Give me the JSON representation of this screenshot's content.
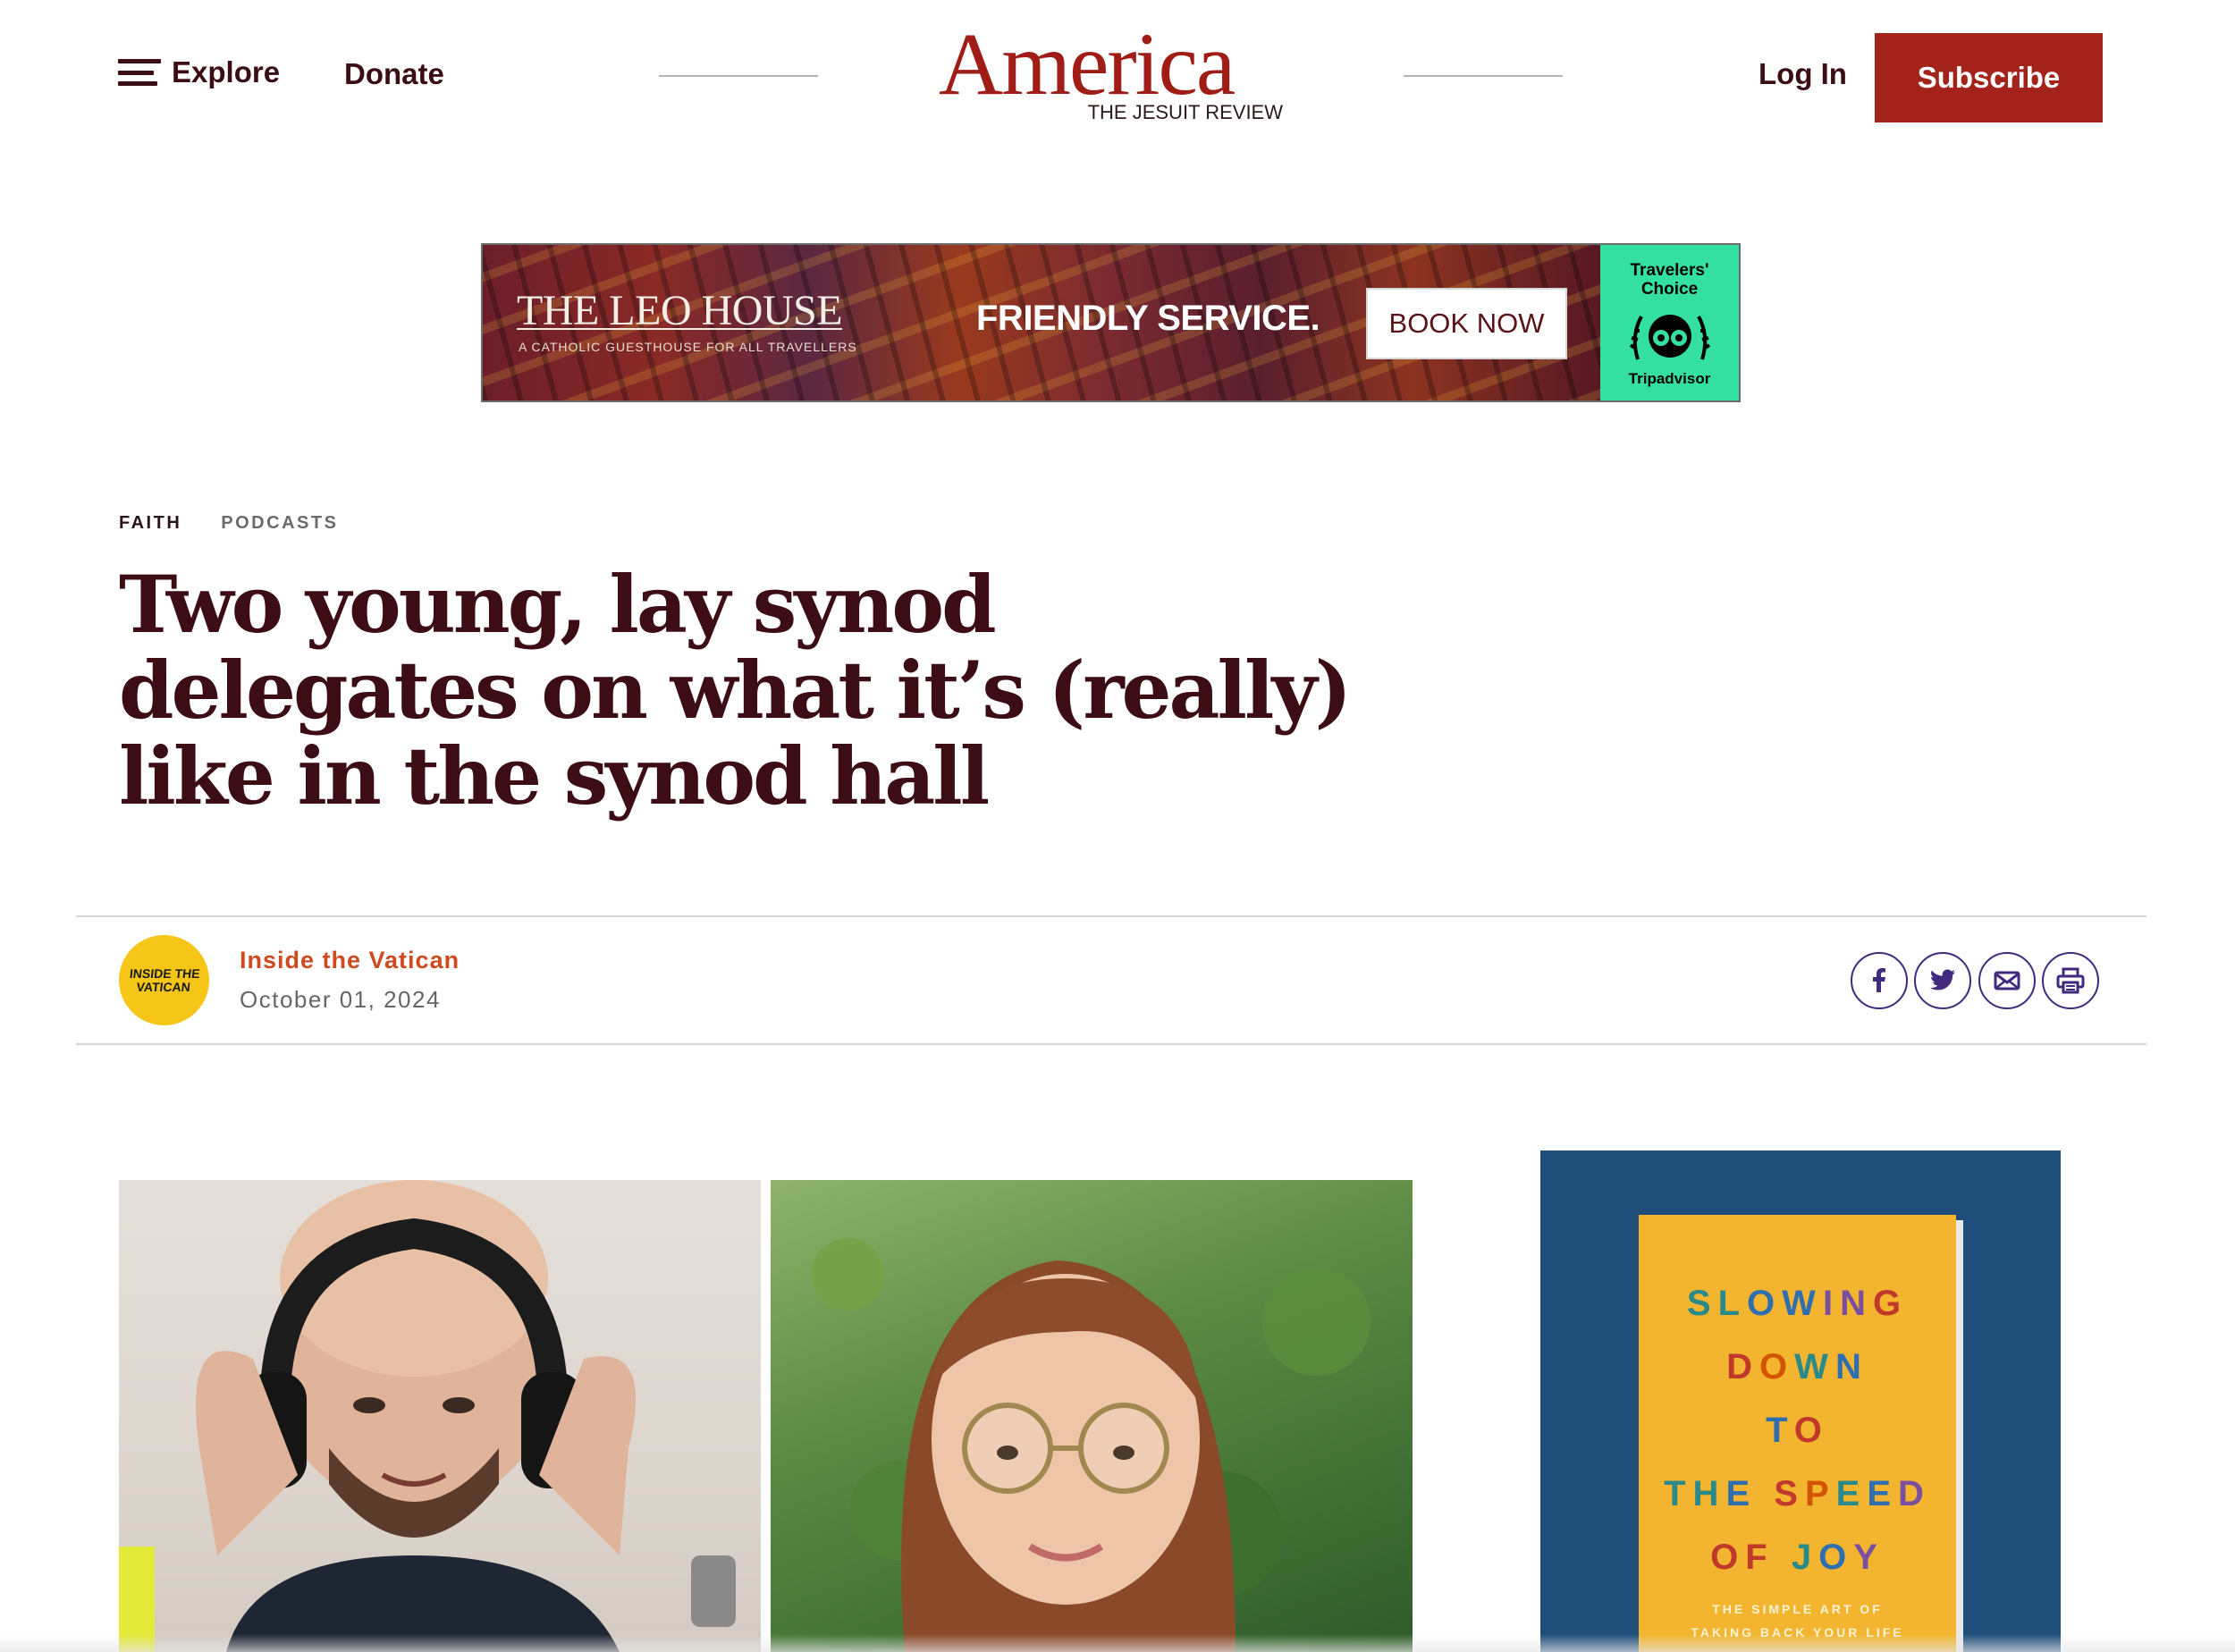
{
  "header": {
    "explore_label": "Explore",
    "donate_label": "Donate",
    "logo_name": "America",
    "logo_tagline": "THE JESUIT REVIEW",
    "login_label": "Log In",
    "subscribe_label": "Subscribe",
    "brand_color": "#a3231a"
  },
  "ad_banner": {
    "title": "THE LEO HOUSE",
    "subtitle": "A CATHOLIC GUESTHOUSE FOR ALL TRAVELLERS",
    "tagline": "FRIENDLY SERVICE.",
    "cta_label": "BOOK NOW",
    "badge_top": "Travelers' Choice",
    "badge_bottom": "Tripadvisor",
    "badge_icon": "owl-icon"
  },
  "article": {
    "tags": [
      "FAITH",
      "PODCASTS"
    ],
    "headline": "Two young, lay synod delegates on what it’s (really) like in the synod hall",
    "author": "Inside the Vatican",
    "avatar_text": "INSIDE THE VATICAN",
    "date": "October 01, 2024",
    "author_color": "#cf4a1f"
  },
  "share": {
    "icons": [
      "facebook-icon",
      "twitter-icon",
      "email-icon",
      "print-icon"
    ]
  },
  "book_ad": {
    "lines": [
      [
        {
          "t": "S",
          "c": "#2a8a8a"
        },
        {
          "t": "L",
          "c": "#2a8a8a"
        },
        {
          "t": "O",
          "c": "#2f6fb0"
        },
        {
          "t": "W",
          "c": "#2f6fb0"
        },
        {
          "t": "I",
          "c": "#7a4fa0"
        },
        {
          "t": "N",
          "c": "#7a4fa0"
        },
        {
          "t": "G",
          "c": "#c0392b"
        }
      ],
      [
        {
          "t": "D",
          "c": "#c0392b"
        },
        {
          "t": "O",
          "c": "#d35400"
        },
        {
          "t": "W",
          "c": "#2a8a8a"
        },
        {
          "t": "N",
          "c": "#2f6fb0"
        }
      ],
      [
        {
          "t": "T",
          "c": "#2f6fb0"
        },
        {
          "t": "O",
          "c": "#c0392b"
        }
      ],
      [
        {
          "t": "T",
          "c": "#2a8a8a"
        },
        {
          "t": "H",
          "c": "#2a8a8a"
        },
        {
          "t": "E",
          "c": "#2f6fb0"
        },
        {
          "t": " ",
          "c": "#000"
        },
        {
          "t": "S",
          "c": "#c0392b"
        },
        {
          "t": "P",
          "c": "#d35400"
        },
        {
          "t": "E",
          "c": "#2a8a8a"
        },
        {
          "t": "E",
          "c": "#2f6fb0"
        },
        {
          "t": "D",
          "c": "#7a4fa0"
        }
      ],
      [
        {
          "t": "O",
          "c": "#c0392b"
        },
        {
          "t": "F",
          "c": "#c0392b"
        },
        {
          "t": " ",
          "c": "#000"
        },
        {
          "t": "J",
          "c": "#2a8a8a"
        },
        {
          "t": "O",
          "c": "#2f6fb0"
        },
        {
          "t": "Y",
          "c": "#7a4fa0"
        }
      ]
    ],
    "subtitle_1": "THE SIMPLE ART OF",
    "subtitle_2": "TAKING BACK YOUR LIFE"
  }
}
